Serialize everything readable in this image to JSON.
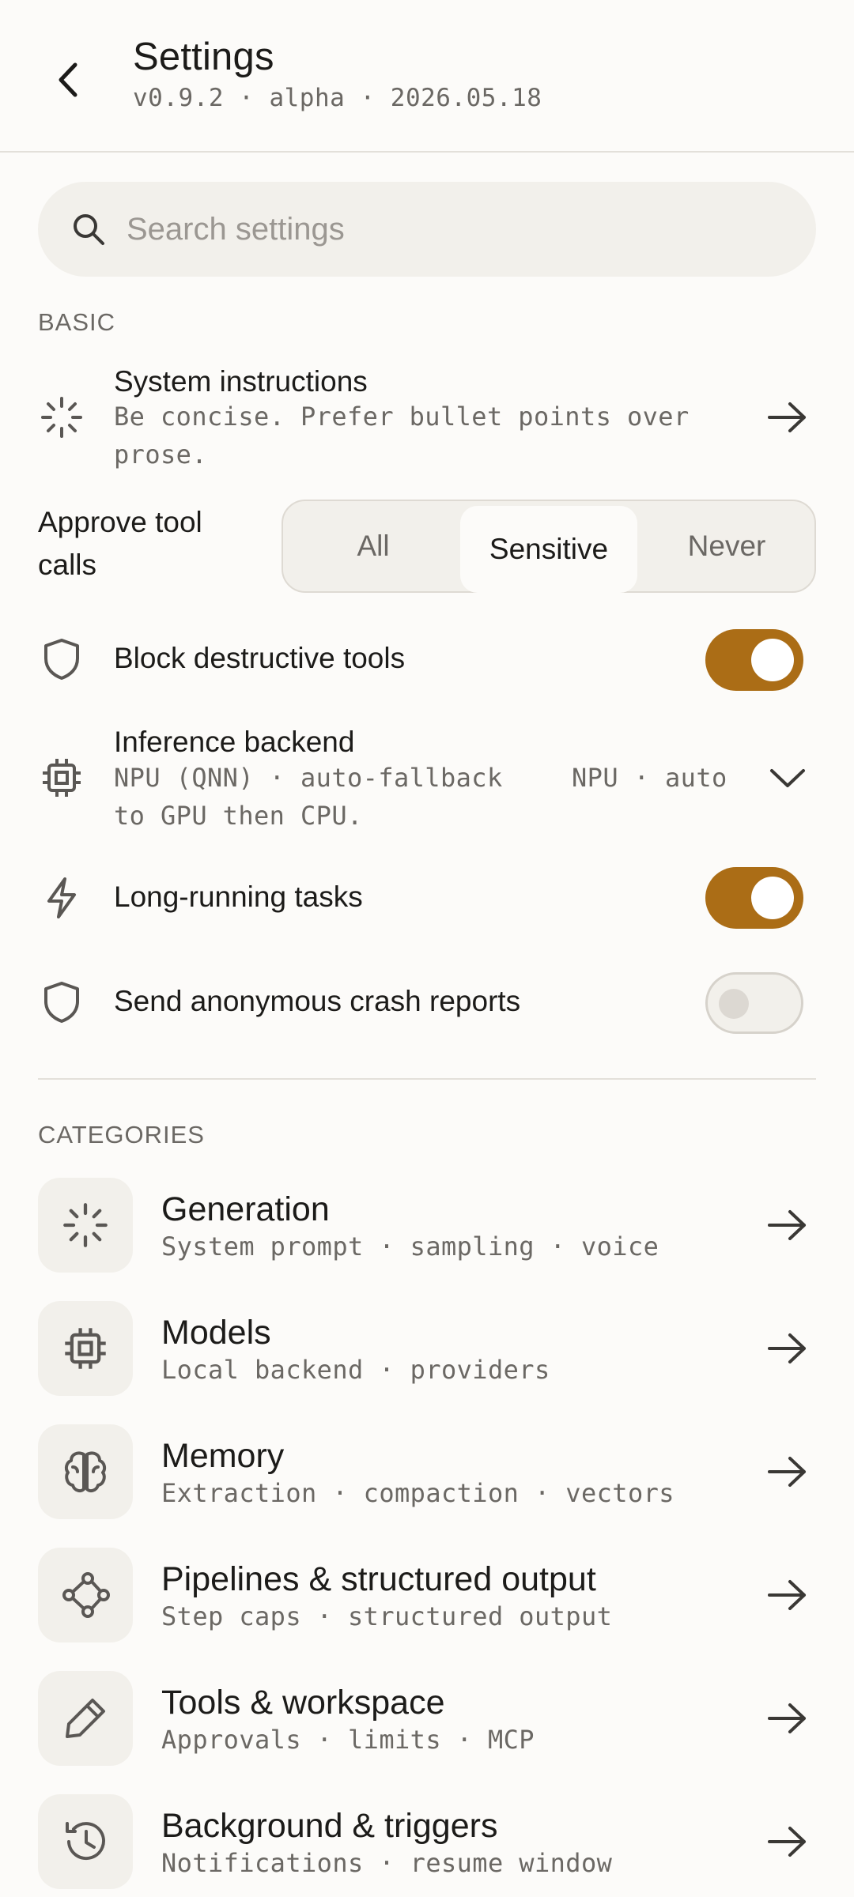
{
  "header": {
    "title": "Settings",
    "version_line": "v0.9.2 · alpha · 2026.05.18",
    "back_icon": "chevron-left-icon"
  },
  "search": {
    "placeholder": "Search settings",
    "icon": "search-icon"
  },
  "basic": {
    "label": "BASIC",
    "system_instructions": {
      "title": "System instructions",
      "value_line1": "Be concise. Prefer bullet points over",
      "value_line2": "prose.",
      "icon": "sparkle-icon"
    },
    "approve_tool_calls": {
      "label_line1": "Approve tool",
      "label_line2": "calls",
      "options": [
        "All",
        "Sensitive",
        "Never"
      ],
      "selected": "Sensitive"
    },
    "block_destructive": {
      "title": "Block destructive tools",
      "enabled": true,
      "icon": "shield-icon"
    },
    "inference_backend": {
      "title": "Inference backend",
      "desc_line1": "NPU (QNN) · auto-fallback",
      "desc_line2": "to GPU then CPU.",
      "selected_value": "NPU · auto",
      "icon": "chip-icon"
    },
    "long_running": {
      "title": "Long-running tasks",
      "enabled": true,
      "icon": "lightning-icon"
    },
    "crash_reports": {
      "title": "Send anonymous crash reports",
      "enabled": false,
      "icon": "shield-icon"
    }
  },
  "categories": {
    "label": "CATEGORIES",
    "items": [
      {
        "title": "Generation",
        "desc": "System prompt · sampling · voice",
        "icon": "sparkle-icon"
      },
      {
        "title": "Models",
        "desc": "Local backend · providers",
        "icon": "chip-icon"
      },
      {
        "title": "Memory",
        "desc": "Extraction · compaction · vectors",
        "icon": "brain-icon"
      },
      {
        "title": "Pipelines & structured output",
        "desc": "Step caps · structured output",
        "icon": "graph-nodes-icon"
      },
      {
        "title": "Tools & workspace",
        "desc": "Approvals · limits · MCP",
        "icon": "pencil-icon"
      },
      {
        "title": "Background & triggers",
        "desc": "Notifications · resume window",
        "icon": "history-icon"
      }
    ]
  },
  "colors": {
    "accent": "#ab6d16",
    "background": "#fcfbf9",
    "surface": "#f2f0eb",
    "muted_text": "#6b6864"
  }
}
